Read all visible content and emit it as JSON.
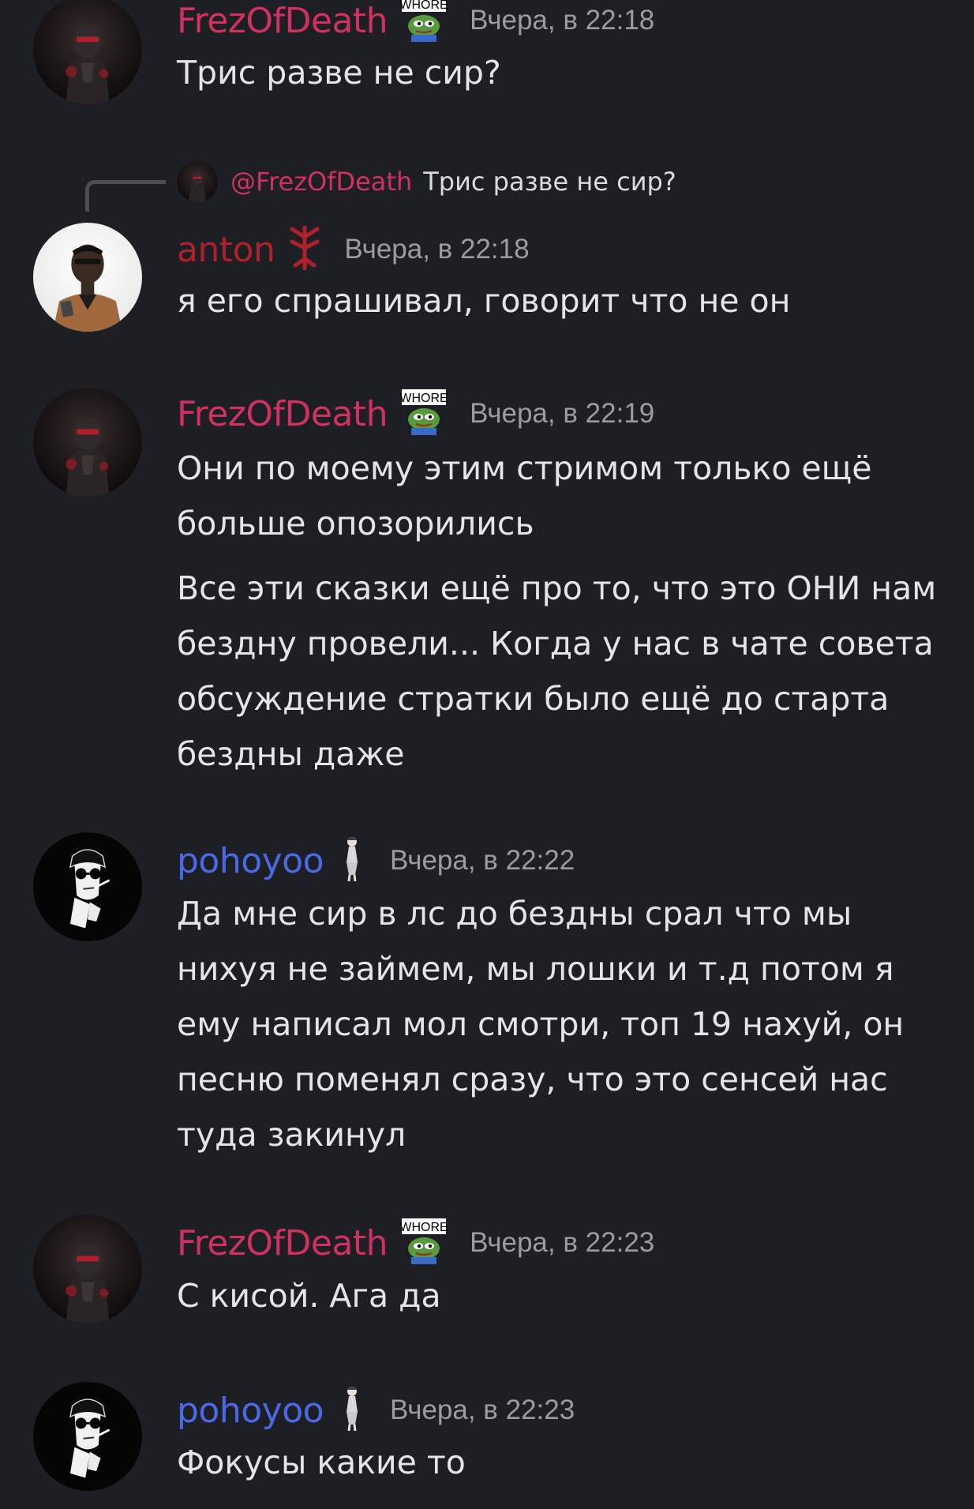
{
  "colors": {
    "background": "#1e1f24",
    "frez_name": "#d0315f",
    "anton_name": "#b0202a",
    "pohoyoo_name": "#4a69e6",
    "timestamp": "#9a9ca3",
    "message_text": "#e3e5e8"
  },
  "messages": [
    {
      "username": "FrezOfDeath",
      "badge_icon": "pepe-whore-icon",
      "badge_text": "WHORE",
      "timestamp": "Вчера, в 22:18",
      "lines": [
        "Трис разве не сир?"
      ]
    },
    {
      "reply": {
        "mention": "@FrezOfDeath",
        "text": "Трис разве не сир?"
      },
      "username": "anton",
      "badge_icon": "berserk-mark-icon",
      "timestamp": "Вчера, в 22:18",
      "lines": [
        "я его спрашивал, говорит что не он"
      ]
    },
    {
      "username": "FrezOfDeath",
      "badge_icon": "pepe-whore-icon",
      "badge_text": "WHORE",
      "timestamp": "Вчера, в 22:19",
      "lines": [
        "Они по моему этим стримом только ещё больше опозорились",
        "Все эти сказки ещё про то, что это ОНИ нам бездну провели... Когда у нас в чате совета обсуждение стратки было ещё до старта бездны даже"
      ]
    },
    {
      "username": "pohoyoo",
      "badge_icon": "anime-figure-icon",
      "timestamp": "Вчера, в 22:22",
      "lines": [
        "Да мне сир в лс до бездны срал что мы нихуя не займем, мы лошки и т.д потом я ему написал мол смотри, топ 19 нахуй, он песню поменял сразу, что это сенсей нас туда закинул"
      ]
    },
    {
      "username": "FrezOfDeath",
      "badge_icon": "pepe-whore-icon",
      "badge_text": "WHORE",
      "timestamp": "Вчера, в 22:23",
      "lines": [
        "С кисой. Ага да"
      ]
    },
    {
      "username": "pohoyoo",
      "badge_icon": "anime-figure-icon",
      "timestamp": "Вчера, в 22:23",
      "lines": [
        "Фокусы какие то"
      ]
    }
  ]
}
